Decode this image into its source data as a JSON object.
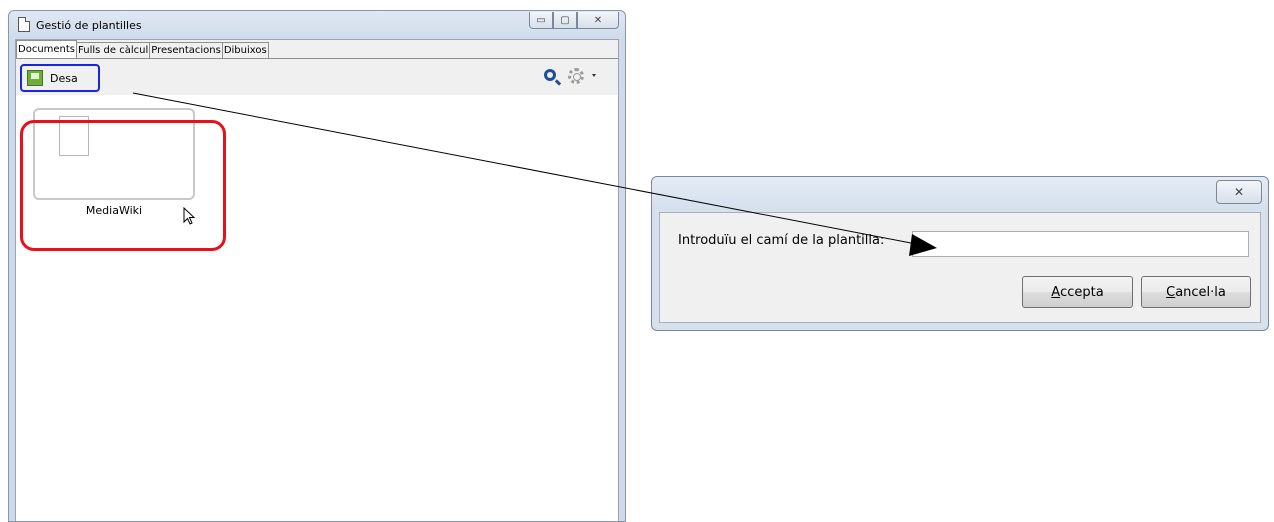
{
  "window": {
    "title": "Gestió de plantilles",
    "tabs": [
      "Documents",
      "Fulls de càlcul",
      "Presentacions",
      "Dibuixos"
    ],
    "active_tab": "Documents",
    "toolbar": {
      "save_label": "Desa"
    },
    "templates": [
      {
        "label": "MediaWiki"
      }
    ]
  },
  "dialog": {
    "prompt": "Introduïu el camí de la plantilla:",
    "path_value": "",
    "ok_label_accel": "A",
    "ok_label_rest": "ccepta",
    "cancel_label_accel": "C",
    "cancel_label_rest": "ancel·la"
  },
  "colors": {
    "highlight_save": "#1826e0",
    "highlight_template": "#e8101a"
  }
}
